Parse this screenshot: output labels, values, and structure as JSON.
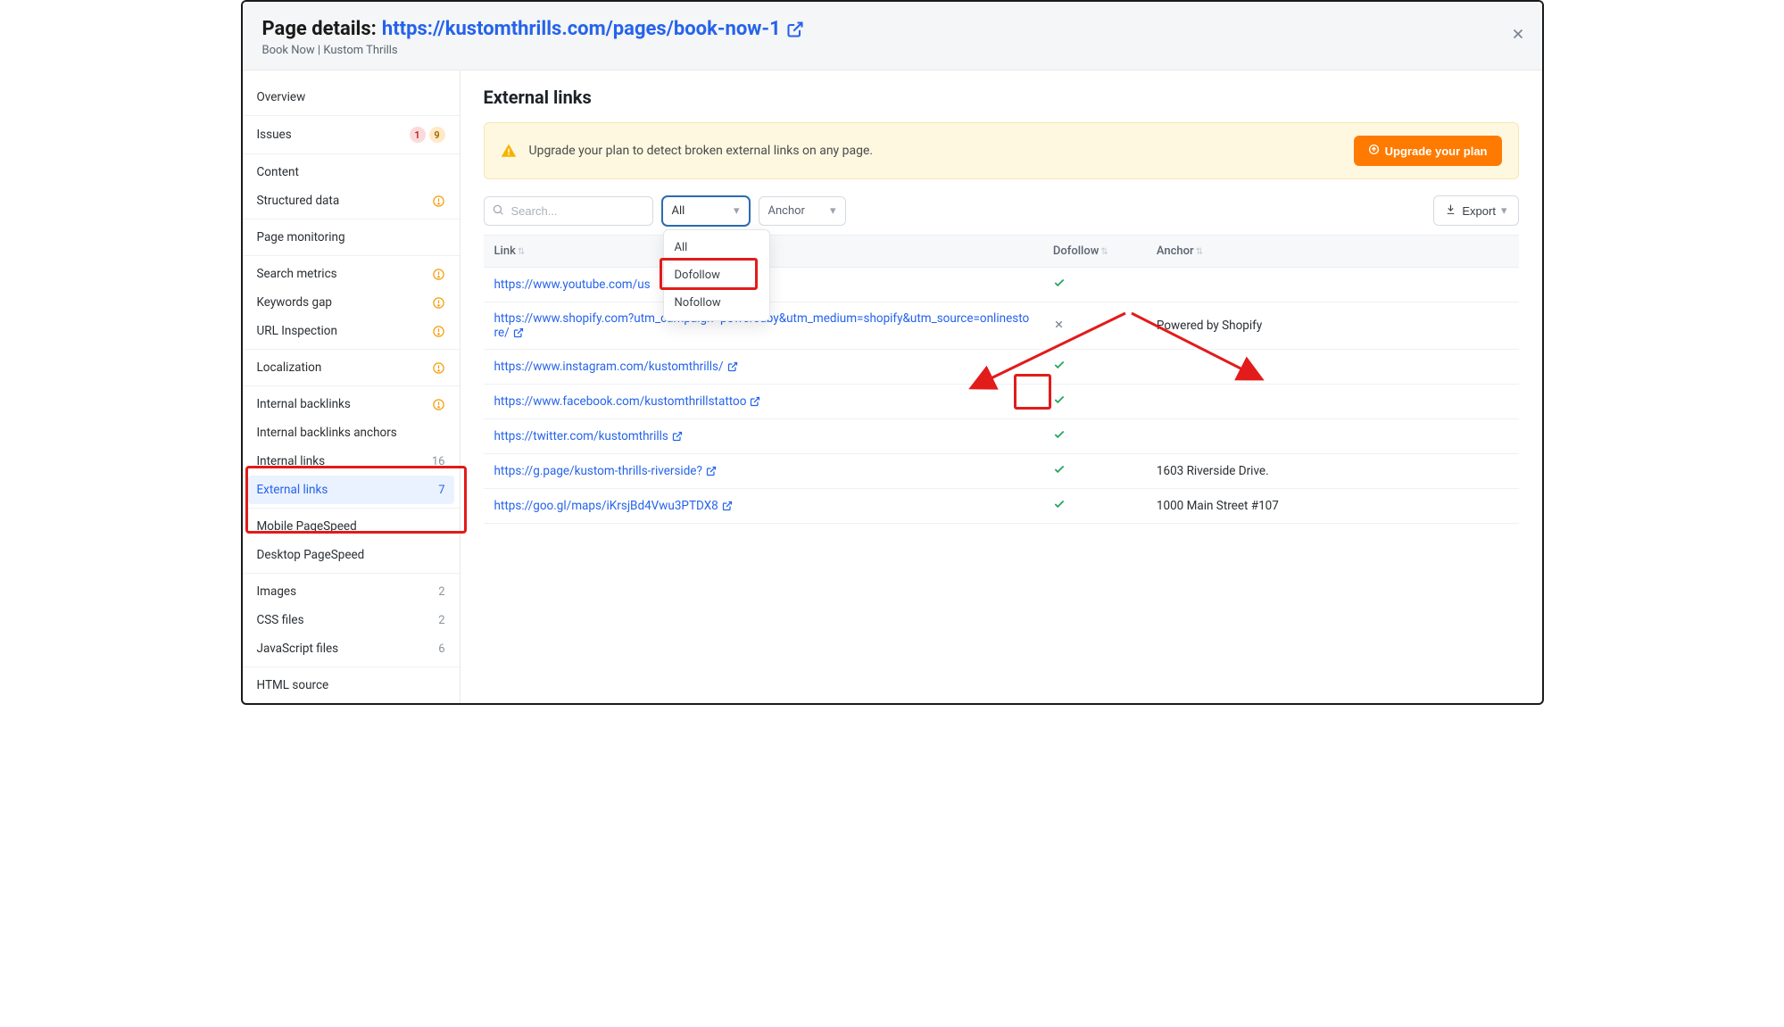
{
  "header": {
    "title_prefix": "Page details: ",
    "url": "https://kustomthrills.com/pages/book-now-1",
    "sub": "Book Now | Kustom Thrills"
  },
  "sidebar": {
    "overview": "Overview",
    "issues": {
      "label": "Issues",
      "red": "1",
      "amber": "9"
    },
    "content": "Content",
    "structured": "Structured data",
    "monitoring": "Page monitoring",
    "search_metrics": "Search metrics",
    "keywords_gap": "Keywords gap",
    "url_inspection": "URL Inspection",
    "localization": "Localization",
    "internal_backlinks": "Internal backlinks",
    "internal_backlinks_anchors": "Internal backlinks anchors",
    "internal_links": {
      "label": "Internal links",
      "count": "16"
    },
    "external_links": {
      "label": "External links",
      "count": "7"
    },
    "mobile_ps": "Mobile PageSpeed",
    "desktop_ps": "Desktop PageSpeed",
    "images": {
      "label": "Images",
      "count": "2"
    },
    "css": {
      "label": "CSS files",
      "count": "2"
    },
    "js": {
      "label": "JavaScript files",
      "count": "6"
    },
    "html_source": "HTML source"
  },
  "main": {
    "heading": "External links",
    "upgrade_text": "Upgrade your plan to detect broken external links on any page.",
    "upgrade_cta": "Upgrade your plan",
    "search_placeholder": "Search...",
    "filter_all": "All",
    "dropdown": {
      "opt1": "All",
      "opt2": "Dofollow",
      "opt3": "Nofollow"
    },
    "filter_anchor": "Anchor",
    "export": "Export"
  },
  "table": {
    "head": {
      "link": "Link",
      "dofollow": "Dofollow",
      "anchor": "Anchor"
    },
    "rows": [
      {
        "url": "https://www.youtube.com/us",
        "truncated": true,
        "dofollow": true,
        "anchor": ""
      },
      {
        "url": "https://www.shopify.com?utm_campaign=poweredby&utm_medium=shopify&utm_source=onlinestore/",
        "truncated": false,
        "dofollow": false,
        "anchor": "Powered by Shopify"
      },
      {
        "url": "https://www.instagram.com/kustomthrills/",
        "truncated": false,
        "dofollow": true,
        "anchor": ""
      },
      {
        "url": "https://www.facebook.com/kustomthrillstattoo",
        "truncated": false,
        "dofollow": true,
        "anchor": ""
      },
      {
        "url": "https://twitter.com/kustomthrills",
        "truncated": false,
        "dofollow": true,
        "anchor": ""
      },
      {
        "url": "https://g.page/kustom-thrills-riverside?",
        "truncated": false,
        "dofollow": true,
        "anchor": "1603 Riverside Drive."
      },
      {
        "url": "https://goo.gl/maps/iKrsjBd4Vwu3PTDX8",
        "truncated": false,
        "dofollow": true,
        "anchor": "1000 Main Street #107"
      }
    ]
  }
}
